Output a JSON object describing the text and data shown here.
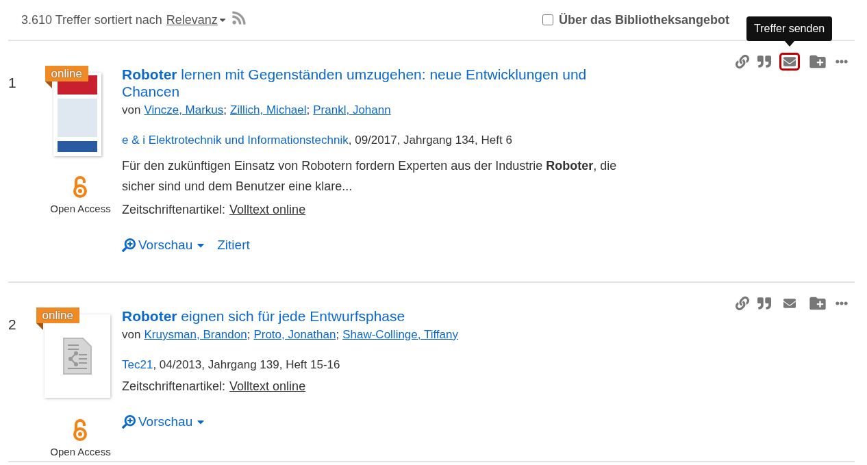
{
  "header": {
    "count_text": "3.610 Treffer sortiert nach",
    "sort": "Relevanz",
    "checkbox": {
      "label": "Über das Bibliotheksangebot",
      "checked": false
    }
  },
  "tooltip": "Treffer senden",
  "results": [
    {
      "number": "1",
      "badge": "online",
      "kind": "cover",
      "open_access": "Open Access",
      "title": "**Roboter** lernen mit Gegenständen umzugehen: neue Entwicklungen und Chancen",
      "von": "von",
      "separator": ";",
      "authors": [
        "Vincze, Markus",
        "Zillich, Michael",
        "Prankl, Johann"
      ],
      "source_link": "e & i Elektrotechnik und Informationstechnik",
      "source_rest": ", 09/2017, Jahrgang 134, Heft 6",
      "snippet": "Für den zukünftigen Einsatz von Robotern fordern Experten aus der Industrie **Roboter**, die sicher sind und dem Benutzer eine klare...",
      "type_label": "Zeitschriftenartikel:",
      "fulltext": "Volltext online",
      "preview": "Vorschau",
      "cited": "Zitiert",
      "mail_highlighted": true
    },
    {
      "number": "2",
      "badge": "online",
      "kind": "document",
      "open_access": "Open Access",
      "title": "**Roboter** eignen sich für jede Entwurfsphase",
      "von": "von",
      "separator": ";",
      "authors": [
        "Kruysman, Brandon",
        "Proto, Jonathan",
        "Shaw-Collinge, Tiffany"
      ],
      "source_link": "Tec21",
      "source_rest": ", 04/2013, Jahrgang 139, Heft 15-16",
      "type_label": "Zeitschriftenartikel:",
      "fulltext": "Volltext online",
      "preview": "Vorschau",
      "mail_highlighted": false
    }
  ]
}
